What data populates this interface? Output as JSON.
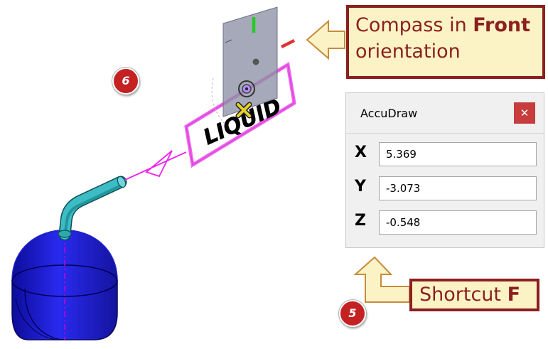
{
  "callouts": {
    "compass": {
      "line1_pre": "Compass in ",
      "line1_bold": "Front",
      "line2": "orientation"
    },
    "shortcut": {
      "pre": "Shortcut ",
      "bold": "F"
    }
  },
  "badges": {
    "step6": "6",
    "step5": "5"
  },
  "accudraw": {
    "title": "AccuDraw",
    "close_glyph": "✕",
    "fields": [
      {
        "axis": "X",
        "value": "5.369"
      },
      {
        "axis": "Y",
        "value": "-3.073"
      },
      {
        "axis": "Z",
        "value": "-0.548"
      }
    ]
  },
  "scene": {
    "tag_text": "LIQUID"
  },
  "colors": {
    "callout_fill": "#fbf3c6",
    "callout_border": "#8c1f1f",
    "badge_red": "#c42222",
    "tank_blue": "#1f1fd6",
    "pipe_teal": "#3cbcc4",
    "magenta": "#ee22ee",
    "close_button": "#c73c3c"
  }
}
